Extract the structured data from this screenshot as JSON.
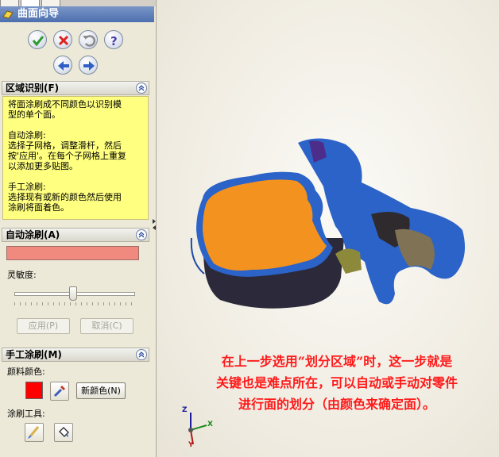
{
  "wizard": {
    "title": "曲面向导"
  },
  "region_identify": {
    "header": "区域识别(F)",
    "hint_paragraphs": [
      "将面涂刷成不同颜色以识别模\n型的单个面。",
      "自动涂刷:\n选择子网格，调整滑杆，然后\n按'应用'。在每个子网格上重复\n以添加更多贴图。",
      "手工涂刷:\n选择现有或新的颜色然后使用\n涂刷将面着色。"
    ]
  },
  "auto_paint": {
    "header": "自动涂刷(A)",
    "sensitivity_label": "灵敏度:",
    "apply_label": "应用(P)",
    "cancel_label": "取消(C)",
    "color": "#f08a7f"
  },
  "manual_paint": {
    "header": "手工涂刷(M)",
    "paint_color_label": "颜料颜色:",
    "new_color_label": "新颜色(N)",
    "tools_label": "涂刷工具:",
    "swatch_color": "#ff0000"
  },
  "annotation": {
    "lines": [
      "在上一步选用“划分区域”时，这一步就是",
      "关键也是难点所在，可以自动或手动对零件",
      "进行面的划分（由颜色来确定面）。"
    ]
  },
  "triad": {
    "z": "Z",
    "x": "X",
    "y": "Y"
  },
  "icons": [
    "ok-icon",
    "cancel-icon",
    "undo-icon",
    "help-icon",
    "back-arrow-icon",
    "next-arrow-icon",
    "eyedropper-icon",
    "brush-icon",
    "bucket-icon"
  ]
}
